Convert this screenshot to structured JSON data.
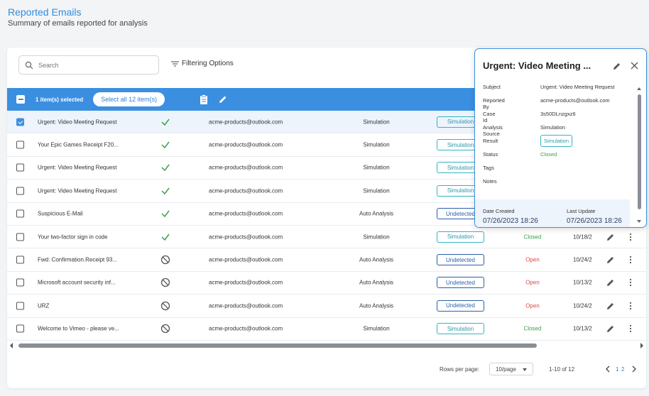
{
  "header": {
    "title": "Reported Emails",
    "subtitle": "Summary of emails reported for analysis"
  },
  "toolbar": {
    "search_placeholder": "Search",
    "filter_label": "Filtering Options"
  },
  "selection": {
    "count_label": "1 item(s) selected",
    "select_all_label": "Select all 12 item(s)"
  },
  "rows": [
    {
      "subject": "Urgent: Video Meeting Request",
      "checked": true,
      "icon": "check-icon",
      "reporter": "acme-products@outlook.com",
      "source": "Simulation",
      "result": "Simulation",
      "status": "",
      "date": ""
    },
    {
      "subject": "Your Epic Games Receipt F20...",
      "checked": false,
      "icon": "check-icon",
      "reporter": "acme-products@outlook.com",
      "source": "Simulation",
      "result": "Simulation",
      "status": "",
      "date": ""
    },
    {
      "subject": "Urgent: Video Meeting Request",
      "checked": false,
      "icon": "check-icon",
      "reporter": "acme-products@outlook.com",
      "source": "Simulation",
      "result": "Simulation",
      "status": "",
      "date": ""
    },
    {
      "subject": "Urgent: Video Meeting Request",
      "checked": false,
      "icon": "check-icon",
      "reporter": "acme-products@outlook.com",
      "source": "Simulation",
      "result": "Simulation",
      "status": "",
      "date": ""
    },
    {
      "subject": "Suspicious E-Mail",
      "checked": false,
      "icon": "check-icon",
      "reporter": "acme-products@outlook.com",
      "source": "Auto Analysis",
      "result": "Undetected",
      "status": "",
      "date": ""
    },
    {
      "subject": "Your two-factor sign in code",
      "checked": false,
      "icon": "check-icon",
      "reporter": "acme-products@outlook.com",
      "source": "Simulation",
      "result": "Simulation",
      "status": "Closed",
      "date": "10/18/2"
    },
    {
      "subject": "Fwd: Confirmation.Receipt 93...",
      "checked": false,
      "icon": "blocked-icon",
      "reporter": "acme-products@outlook.com",
      "source": "Auto Analysis",
      "result": "Undetected",
      "status": "Open",
      "date": "10/24/2"
    },
    {
      "subject": "Microsoft account security inf...",
      "checked": false,
      "icon": "blocked-icon",
      "reporter": "acme-products@outlook.com",
      "source": "Auto Analysis",
      "result": "Undetected",
      "status": "Open",
      "date": "10/13/2"
    },
    {
      "subject": "URZ",
      "checked": false,
      "icon": "blocked-icon",
      "reporter": "acme-products@outlook.com",
      "source": "Auto Analysis",
      "result": "Undetected",
      "status": "Open",
      "date": "10/24/2"
    },
    {
      "subject": "Welcome to Vimeo - please ve...",
      "checked": false,
      "icon": "blocked-icon",
      "reporter": "acme-products@outlook.com",
      "source": "Simulation",
      "result": "Simulation",
      "status": "Closed",
      "date": "10/13/2"
    }
  ],
  "pagination": {
    "rows_per_page_label": "Rows per page:",
    "rows_per_page_value": "10/page",
    "range": "1-10 of 12",
    "page1": "1",
    "page2": "2"
  },
  "detail": {
    "title": "Urgent: Video Meeting ...",
    "fields": [
      {
        "key": "Subject",
        "value": "Urgent: Video Meeting Request"
      },
      {
        "key": "Reported By",
        "value": "acme-products@outlook.com"
      },
      {
        "key": "Case Id",
        "value": "3s50DLnzgxz6"
      },
      {
        "key": "Analysis Source",
        "value": "Simulation"
      },
      {
        "key": "Result",
        "value": "Simulation"
      },
      {
        "key": "Status",
        "value": "Closed"
      },
      {
        "key": "Tags",
        "value": ""
      },
      {
        "key": "Notes",
        "value": ""
      }
    ],
    "date_created_label": "Date Created",
    "date_created": "07/26/2023 18:26",
    "last_update_label": "Last Update",
    "last_update": "07/26/2023 18:26"
  },
  "colors": {
    "accent": "#3b8fe0",
    "open": "#e04848",
    "closed": "#3aa04a",
    "simulation_badge": "#35b4c1",
    "undetected_badge": "#2a5fa8"
  }
}
